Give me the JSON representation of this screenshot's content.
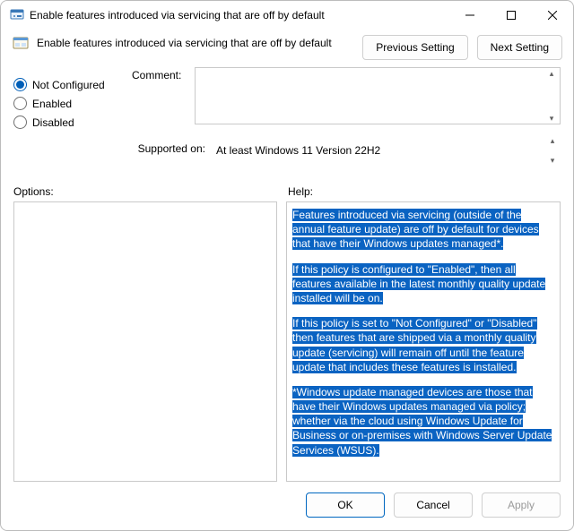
{
  "window": {
    "title": "Enable features introduced via servicing that are off by default"
  },
  "header": {
    "title": "Enable features introduced via servicing that are off by default",
    "prev_label": "Previous Setting",
    "next_label": "Next Setting"
  },
  "state": {
    "options": [
      {
        "key": "not_configured",
        "label": "Not Configured",
        "checked": true
      },
      {
        "key": "enabled",
        "label": "Enabled",
        "checked": false
      },
      {
        "key": "disabled",
        "label": "Disabled",
        "checked": false
      }
    ],
    "comment_label": "Comment:",
    "comment_value": "",
    "supported_label": "Supported on:",
    "supported_value": "At least Windows 11 Version 22H2"
  },
  "sections": {
    "options_label": "Options:",
    "help_label": "Help:"
  },
  "help_paragraphs": [
    "Features introduced via servicing (outside of the annual feature update) are off by default for devices that have their Windows updates managed*.",
    "If this policy is configured to \"Enabled\", then all features available in the latest monthly quality update installed will be on.",
    "If this policy is set to \"Not Configured\" or \"Disabled\" then features that are shipped via a monthly quality update (servicing) will remain off until the feature update that includes these features is installed.",
    "*Windows update managed devices are those that have their Windows updates managed via policy; whether via the cloud using Windows Update for Business or on-premises with Windows Server Update Services (WSUS)."
  ],
  "footer": {
    "ok_label": "OK",
    "cancel_label": "Cancel",
    "apply_label": "Apply"
  }
}
